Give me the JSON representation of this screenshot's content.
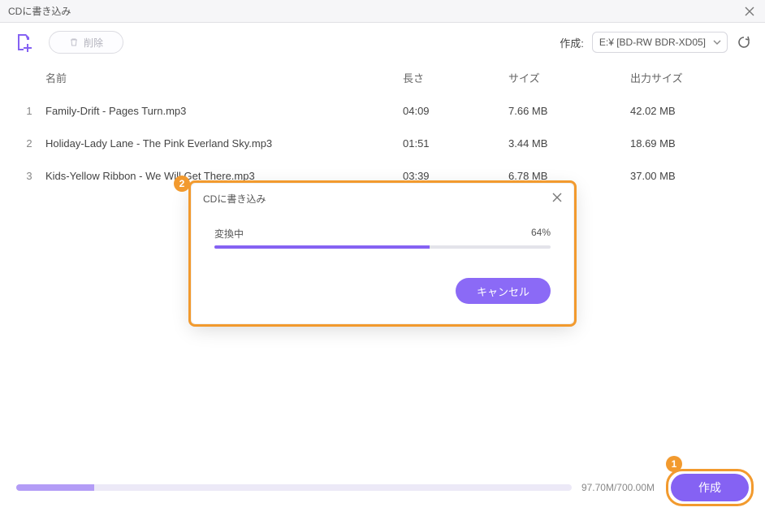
{
  "window": {
    "title": "CDに書き込み"
  },
  "toolbar": {
    "delete_label": "削除",
    "create_label": "作成:",
    "drive_value": "E:¥ [BD-RW  BDR-XD05]"
  },
  "columns": {
    "name": "名前",
    "length": "長さ",
    "size": "サイズ",
    "out": "出力サイズ"
  },
  "rows": [
    {
      "idx": "1",
      "name": "Family-Drift - Pages Turn.mp3",
      "length": "04:09",
      "size": "7.66 MB",
      "out": "42.02 MB"
    },
    {
      "idx": "2",
      "name": "Holiday-Lady Lane - The Pink Everland Sky.mp3",
      "length": "01:51",
      "size": "3.44 MB",
      "out": "18.69 MB"
    },
    {
      "idx": "3",
      "name": "Kids-Yellow Ribbon - We Will Get There.mp3",
      "length": "03:39",
      "size": "6.78 MB",
      "out": "37.00 MB"
    }
  ],
  "footer": {
    "capacity": "97.70M/700.00M",
    "capacity_pct": 14,
    "create_button": "作成"
  },
  "modal": {
    "title": "CDに書き込み",
    "status_label": "変換中",
    "percent_label": "64%",
    "percent": 64,
    "cancel_label": "キャンセル"
  },
  "callouts": {
    "one": "1",
    "two": "2"
  }
}
